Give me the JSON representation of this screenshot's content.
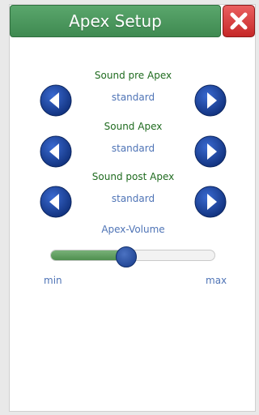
{
  "dialog": {
    "title": "Apex Setup",
    "close_icon": "close-icon"
  },
  "settings": [
    {
      "label": "Sound pre Apex",
      "value": "standard"
    },
    {
      "label": "Sound Apex",
      "value": "standard"
    },
    {
      "label": "Sound post Apex",
      "value": "standard"
    }
  ],
  "volume": {
    "label": "Apex-Volume",
    "min_label": "min",
    "max_label": "max",
    "level": 0.46
  },
  "icons": {
    "prev": "arrow-left-icon",
    "next": "arrow-right-icon"
  },
  "colors": {
    "header": "#4f9a61",
    "close": "#d33636",
    "label": "#1f6b1f",
    "value": "#4f74b6",
    "nav_button": "#163a88",
    "slider_fill": "#5f9f5f"
  }
}
